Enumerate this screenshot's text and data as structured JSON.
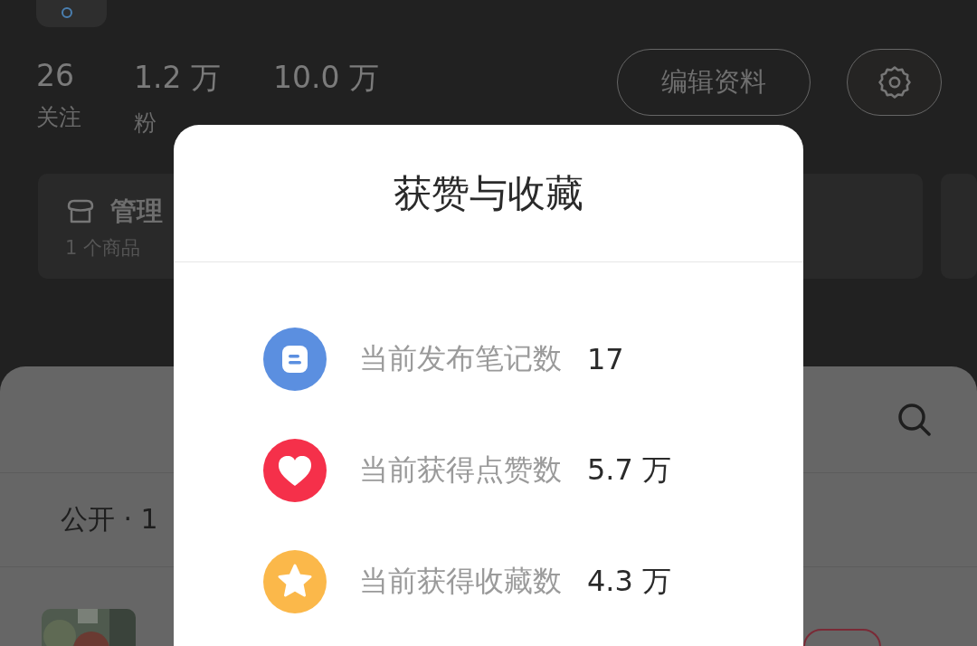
{
  "profile": {
    "stats": [
      {
        "value": "26",
        "label": "关注"
      },
      {
        "value": "1.2 万",
        "label": "粉"
      },
      {
        "value": "10.0 万"
      }
    ],
    "edit_button": "编辑资料",
    "shop_card": {
      "title": "管理",
      "subtitle": "1 个商品"
    }
  },
  "notes_panel": {
    "filter": "公开 · 1"
  },
  "dialog": {
    "title": "获赞与收藏",
    "rows": [
      {
        "kind": "notes",
        "label": "当前发布笔记数",
        "value": "17",
        "color": "#5b8fe0"
      },
      {
        "kind": "likes",
        "label": "当前获得点赞数",
        "value": "5.7 万",
        "color": "#f5304a"
      },
      {
        "kind": "favorites",
        "label": "当前获得收藏数",
        "value": "4.3 万",
        "color": "#fbb84a"
      }
    ]
  }
}
